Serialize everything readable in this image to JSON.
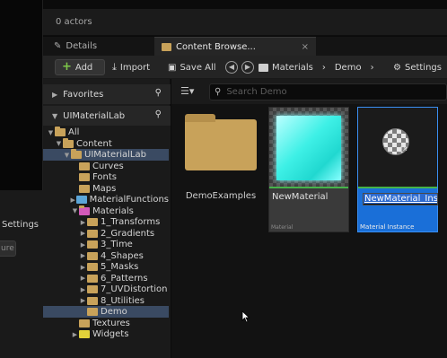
{
  "outliner": {
    "actor_count": "0 actors"
  },
  "left_panel": {
    "settings_label": "Settings",
    "partial_button": "ure"
  },
  "tabs": [
    {
      "label": "Details",
      "icon": "pencil-icon",
      "active": false
    },
    {
      "label": "Content Browse...",
      "icon": "folder-icon",
      "active": true,
      "close": "×"
    }
  ],
  "toolbar": {
    "add_label": "Add",
    "import_label": "Import",
    "save_all_label": "Save All",
    "breadcrumb": [
      "Materials",
      "Demo"
    ],
    "settings_label": "Settings"
  },
  "sidebar": {
    "favorites_label": "Favorites",
    "project_label": "UIMaterialLab",
    "tree": [
      {
        "label": "All",
        "indent": 0,
        "arrow": "▼",
        "icon": "folder",
        "open": true
      },
      {
        "label": "Content",
        "indent": 1,
        "arrow": "▼",
        "icon": "folder",
        "open": true
      },
      {
        "label": "UIMaterialLab",
        "indent": 2,
        "arrow": "▼",
        "icon": "folder",
        "open": true,
        "selected": true
      },
      {
        "label": "Curves",
        "indent": 3,
        "arrow": "",
        "icon": "folder"
      },
      {
        "label": "Fonts",
        "indent": 3,
        "arrow": "",
        "icon": "folder"
      },
      {
        "label": "Maps",
        "indent": 3,
        "arrow": "",
        "icon": "folder"
      },
      {
        "label": "MaterialFunctions",
        "indent": 3,
        "arrow": "▶",
        "icon": "blue"
      },
      {
        "label": "Materials",
        "indent": 3,
        "arrow": "▼",
        "icon": "pink",
        "open": true
      },
      {
        "label": "1_Transforms",
        "indent": 4,
        "arrow": "▶",
        "icon": "folder"
      },
      {
        "label": "2_Gradients",
        "indent": 4,
        "arrow": "▶",
        "icon": "folder"
      },
      {
        "label": "3_Time",
        "indent": 4,
        "arrow": "▶",
        "icon": "folder"
      },
      {
        "label": "4_Shapes",
        "indent": 4,
        "arrow": "▶",
        "icon": "folder"
      },
      {
        "label": "5_Masks",
        "indent": 4,
        "arrow": "▶",
        "icon": "folder"
      },
      {
        "label": "6_Patterns",
        "indent": 4,
        "arrow": "▶",
        "icon": "folder"
      },
      {
        "label": "7_UVDistortion",
        "indent": 4,
        "arrow": "▶",
        "icon": "folder"
      },
      {
        "label": "8_Utilities",
        "indent": 4,
        "arrow": "▶",
        "icon": "folder"
      },
      {
        "label": "Demo",
        "indent": 4,
        "arrow": "",
        "icon": "folder",
        "selected": true
      },
      {
        "label": "Textures",
        "indent": 3,
        "arrow": "",
        "icon": "folder"
      },
      {
        "label": "Widgets",
        "indent": 3,
        "arrow": "▶",
        "icon": "yellow"
      }
    ]
  },
  "content": {
    "search_placeholder": "Search Demo",
    "assets": [
      {
        "name": "DemoExamples",
        "kind": "folder"
      },
      {
        "name": "NewMaterial",
        "kind": "material",
        "type_label": "Material"
      },
      {
        "name": "NewMaterial_Ins",
        "kind": "material-instance",
        "type_label": "Material Instance",
        "renaming": true
      }
    ]
  }
}
